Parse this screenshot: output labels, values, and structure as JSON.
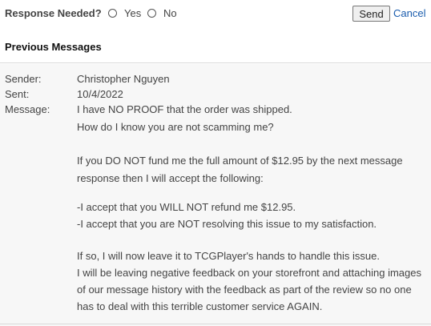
{
  "response": {
    "label": "Response Needed?",
    "options": [
      "Yes",
      "No"
    ],
    "selected": null
  },
  "actions": {
    "send_label": "Send",
    "cancel_label": "Cancel"
  },
  "section": {
    "title": "Previous Messages"
  },
  "message": {
    "sender_label": "Sender:",
    "sender": "Christopher Nguyen",
    "sent_label": "Sent:",
    "sent": "10/4/2022",
    "message_label": "Message:",
    "lines": [
      "I have NO PROOF that the order was shipped.",
      "How do I know you are not scamming me?",
      "",
      "If you DO NOT fund me the full amount of $12.95 by the next message",
      "response then I will accept the following:",
      "",
      "-I accept that you WILL NOT refund me $12.95.",
      "-I accept that you are NOT resolving this issue to my satisfaction.",
      "",
      "If so, I will now leave it to TCGPlayer's hands to handle this issue.",
      "I will be leaving negative feedback on your storefront and attaching images",
      "of our message history with the feedback as part of the review so no one",
      "has to deal with this terrible customer service AGAIN."
    ]
  },
  "colors": {
    "link": "#1a5cad",
    "panel_bg": "#f7f7f7",
    "divider": "#d9d9d9"
  }
}
